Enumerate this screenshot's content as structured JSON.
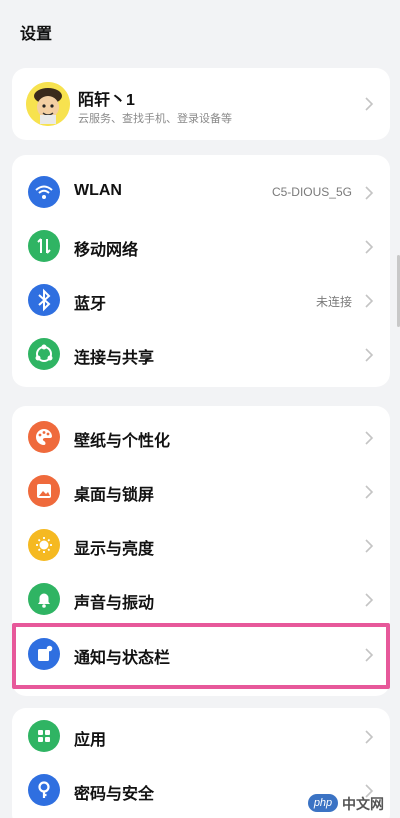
{
  "header": {
    "title": "设置"
  },
  "profile": {
    "name": "陌轩丶1",
    "subtitle": "云服务、查找手机、登录设备等",
    "avatar_icon": "avatar-cartoon"
  },
  "network_group": [
    {
      "label": "WLAN",
      "value": "C5-DIOUS_5G",
      "icon": "wifi-icon",
      "color": "#2f6fe0"
    },
    {
      "label": "移动网络",
      "value": "",
      "icon": "mobile-data-icon",
      "color": "#2fb463"
    },
    {
      "label": "蓝牙",
      "value": "未连接",
      "icon": "bluetooth-icon",
      "color": "#2f6fe0"
    },
    {
      "label": "连接与共享",
      "value": "",
      "icon": "share-icon",
      "color": "#2fb463"
    }
  ],
  "display_group": [
    {
      "label": "壁纸与个性化",
      "icon": "palette-icon",
      "color": "#ef6a3c"
    },
    {
      "label": "桌面与锁屏",
      "icon": "wallpaper-icon",
      "color": "#ef6a3c"
    },
    {
      "label": "显示与亮度",
      "icon": "brightness-icon",
      "color": "#f5b921"
    },
    {
      "label": "声音与振动",
      "icon": "bell-icon",
      "color": "#2fb463"
    },
    {
      "label": "通知与状态栏",
      "icon": "notification-icon",
      "color": "#2f6fe0"
    }
  ],
  "apps_group": [
    {
      "label": "应用",
      "icon": "apps-icon",
      "color": "#2fb463"
    },
    {
      "label": "密码与安全",
      "icon": "key-icon",
      "color": "#2f6fe0"
    }
  ],
  "watermark": {
    "badge": "php",
    "text": "中文网"
  }
}
